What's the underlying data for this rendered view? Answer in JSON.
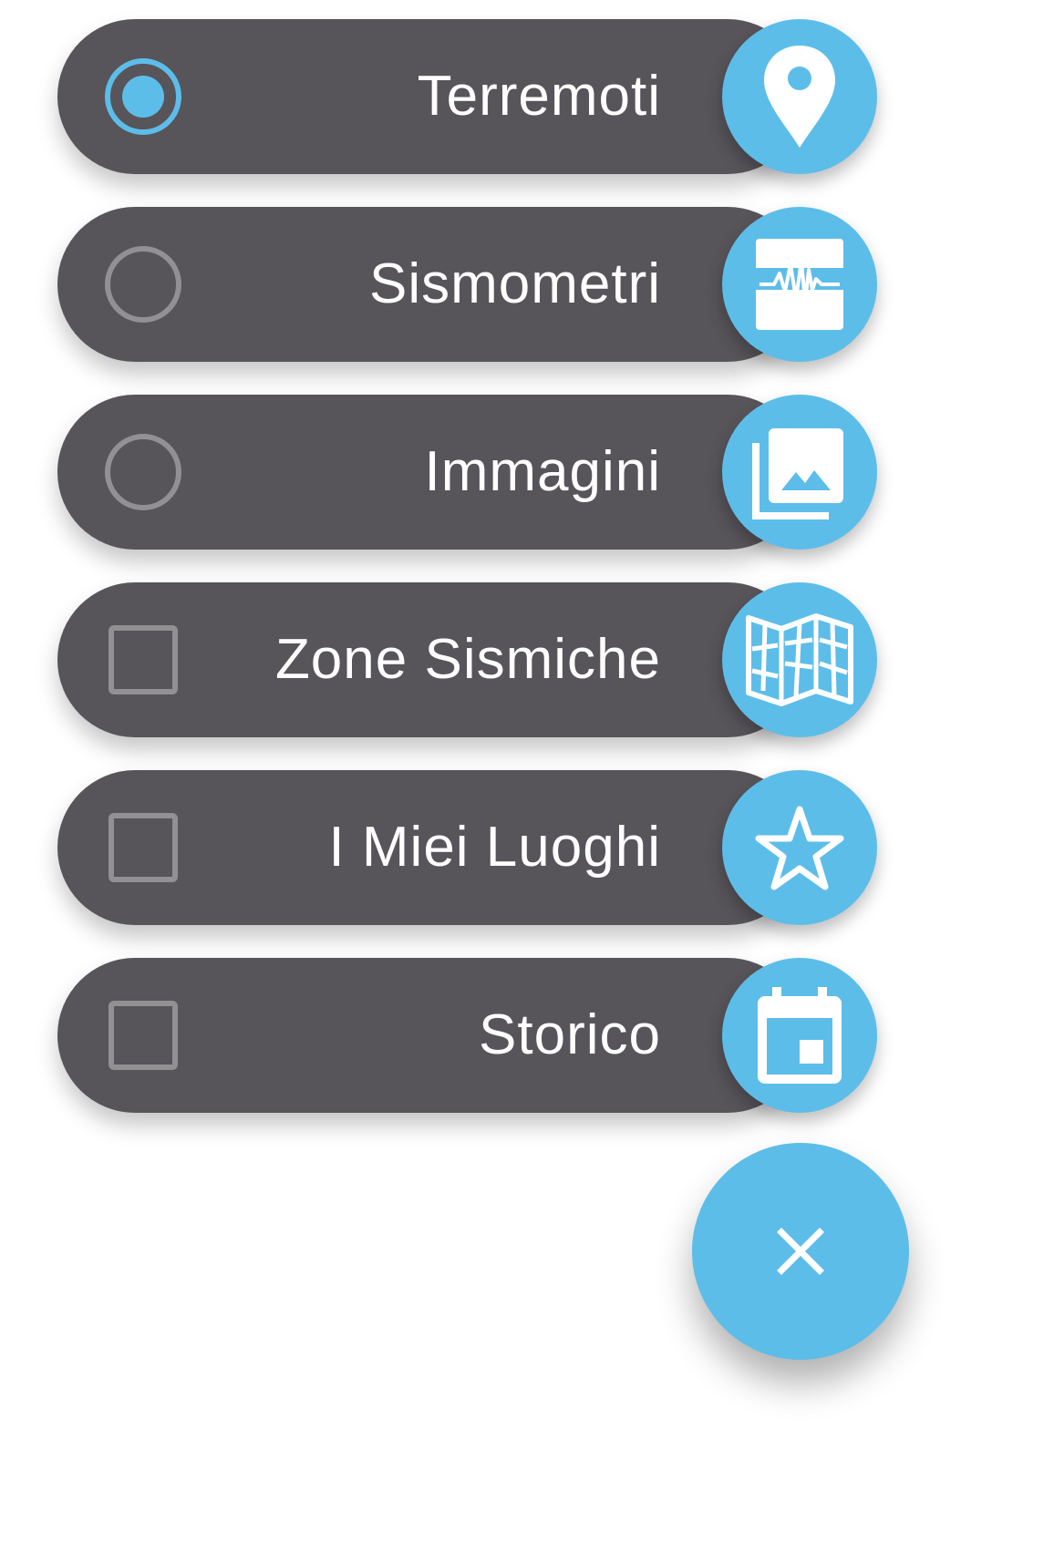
{
  "menu": {
    "items": [
      {
        "label": "Terremoti",
        "control": "radio",
        "selected": true,
        "icon": "map-pin-icon"
      },
      {
        "label": "Sismometri",
        "control": "radio",
        "selected": false,
        "icon": "seismograph-icon"
      },
      {
        "label": "Immagini",
        "control": "radio",
        "selected": false,
        "icon": "image-gallery-icon"
      },
      {
        "label": "Zone Sismiche",
        "control": "checkbox",
        "selected": false,
        "icon": "folded-map-icon"
      },
      {
        "label": "I Miei Luoghi",
        "control": "checkbox",
        "selected": false,
        "icon": "star-icon"
      },
      {
        "label": "Storico",
        "control": "checkbox",
        "selected": false,
        "icon": "calendar-icon"
      }
    ]
  },
  "fab": {
    "icon": "close-icon"
  },
  "colors": {
    "accent": "#5dbde9",
    "item_background": "#57545a",
    "control_inactive": "#929092",
    "text": "#ffffff"
  }
}
